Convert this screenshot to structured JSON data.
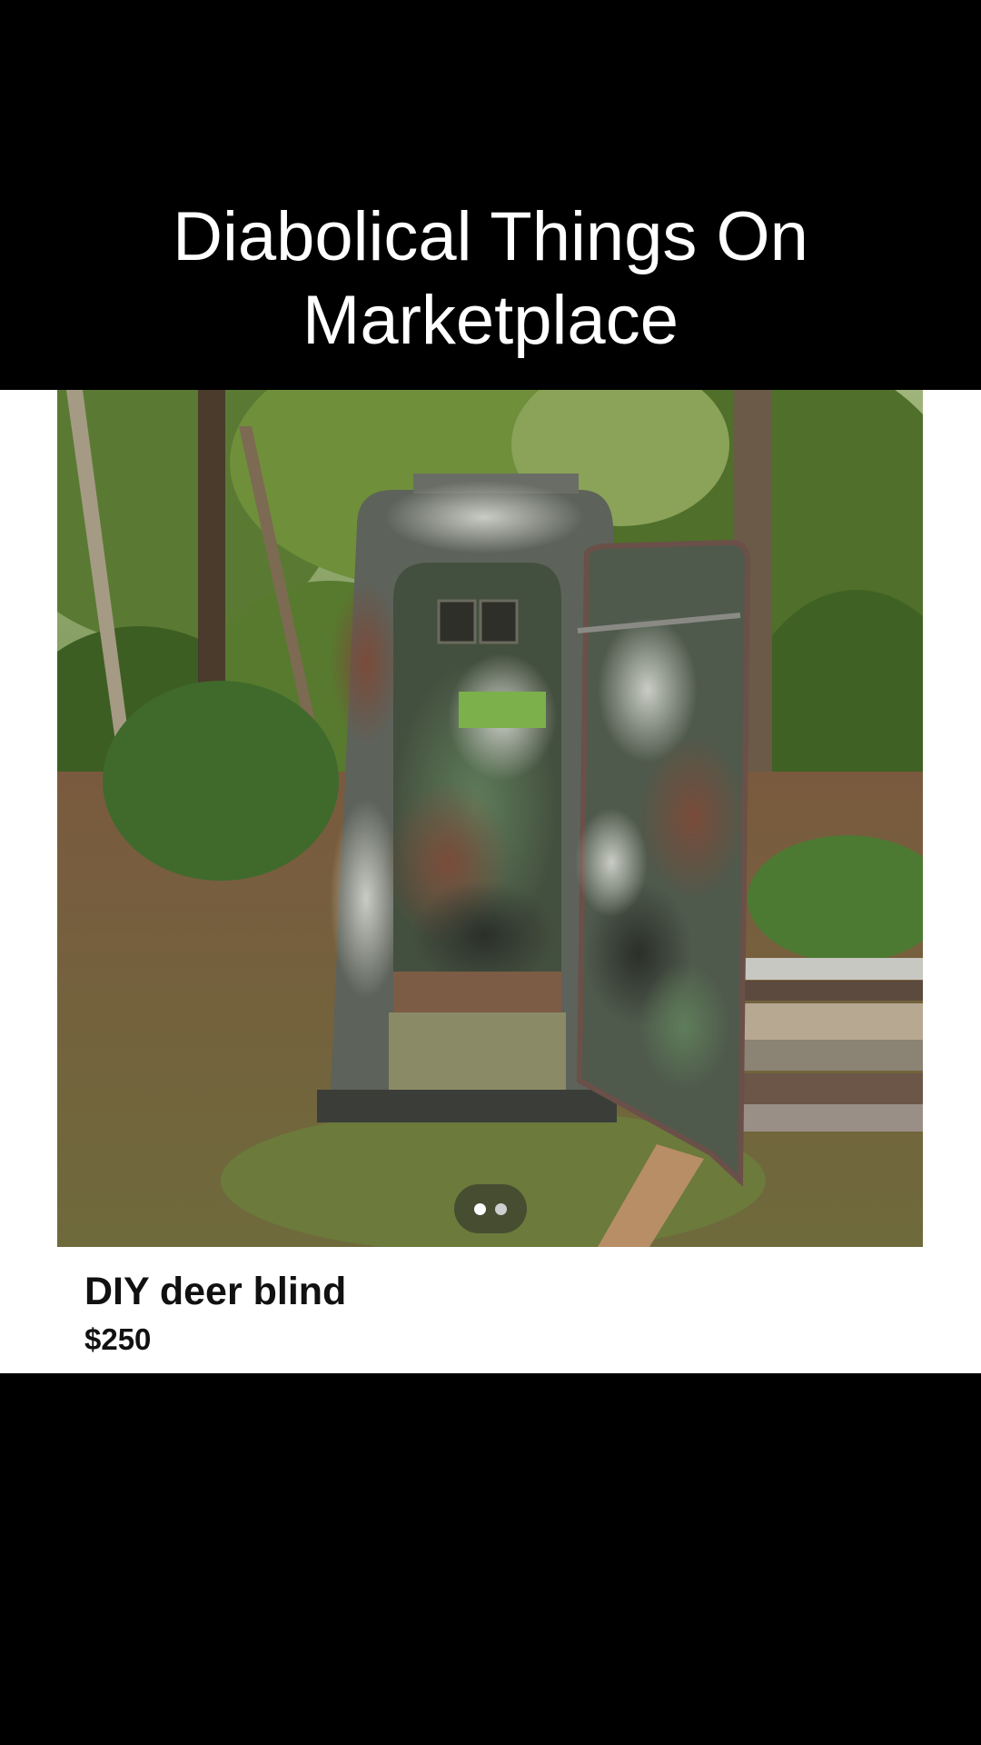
{
  "overlay": {
    "caption_line1": "Diabolical Things On",
    "caption_line2": "Marketplace"
  },
  "listing": {
    "title": "DIY deer blind",
    "price": "$250",
    "photo_count": 2,
    "current_photo": 1
  },
  "colors": {
    "background": "#000000",
    "card": "#ffffff",
    "caption_text": "#ffffff",
    "listing_text": "#111111"
  }
}
